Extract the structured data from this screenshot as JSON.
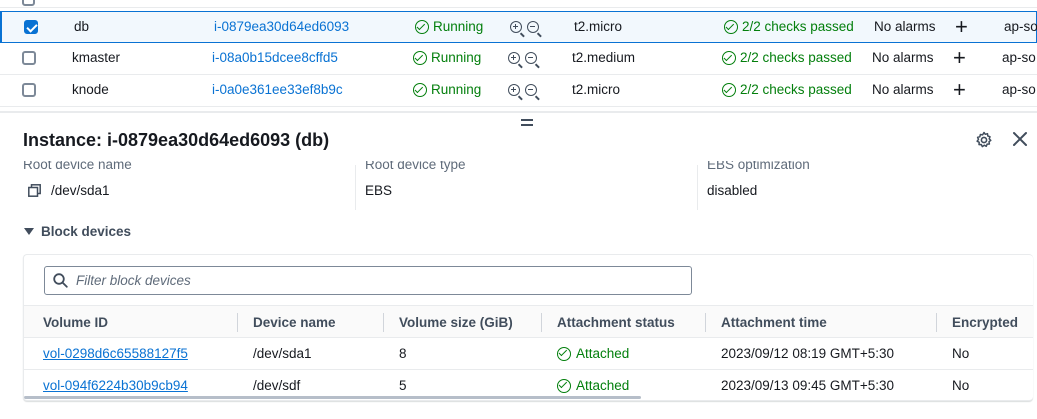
{
  "instances": {
    "rows": [
      {
        "name": "db",
        "instance_id": "i-0879ea30d64ed6093",
        "state": "Running",
        "type": "t2.micro",
        "status_checks": "2/2 checks passed",
        "alarms": "No alarms",
        "az": "ap-so",
        "selected": true
      },
      {
        "name": "kmaster",
        "instance_id": "i-08a0b15dcee8cffd5",
        "state": "Running",
        "type": "t2.medium",
        "status_checks": "2/2 checks passed",
        "alarms": "No alarms",
        "az": "ap-so",
        "selected": false
      },
      {
        "name": "knode",
        "instance_id": "i-0a0e361ee33ef8b9c",
        "state": "Running",
        "type": "t2.micro",
        "status_checks": "2/2 checks passed",
        "alarms": "No alarms",
        "az": "ap-so",
        "selected": false
      }
    ]
  },
  "details": {
    "title": "Instance: i-0879ea30d64ed6093 (db)",
    "fields": [
      {
        "label": "Root device name",
        "value": "/dev/sda1"
      },
      {
        "label": "Root device type",
        "value": "EBS"
      },
      {
        "label": "EBS optimization",
        "value": "disabled"
      }
    ],
    "block_devices": {
      "section_label": "Block devices",
      "filter_placeholder": "Filter block devices",
      "columns": [
        "Volume ID",
        "Device name",
        "Volume size (GiB)",
        "Attachment status",
        "Attachment time",
        "Encrypted"
      ],
      "rows": [
        {
          "volume_id": "vol-0298d6c65588127f5",
          "device": "/dev/sda1",
          "size": "8",
          "status": "Attached",
          "time": "2023/09/12 08:19 GMT+5:30",
          "encrypted": "No"
        },
        {
          "volume_id": "vol-094f6224b30b9cb94",
          "device": "/dev/sdf",
          "size": "5",
          "status": "Attached",
          "time": "2023/09/13 09:45 GMT+5:30",
          "encrypted": "No"
        }
      ]
    }
  },
  "colors": {
    "link": "#0972d3",
    "success": "#037f0c",
    "selected_bg": "#f2f8fd"
  },
  "icons": [
    "checkbox-icon",
    "success-check-icon",
    "zoom-in-icon",
    "zoom-out-icon",
    "plus-icon",
    "drag-handle-icon",
    "settings-gear-icon",
    "close-icon",
    "copy-icon",
    "caret-down-icon",
    "search-icon"
  ]
}
